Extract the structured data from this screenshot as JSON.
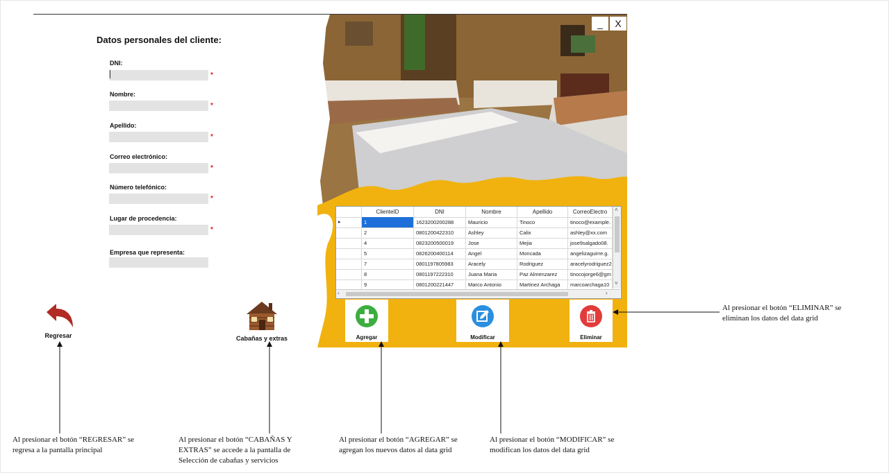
{
  "form": {
    "title": "Datos personales del cliente:",
    "fields": [
      {
        "label": "DNI:",
        "value": "",
        "required": true
      },
      {
        "label": "Nombre:",
        "value": "",
        "required": true
      },
      {
        "label": "Apellido:",
        "value": "",
        "required": true
      },
      {
        "label": "Correo electrónico:",
        "value": "",
        "required": true
      },
      {
        "label": "Número telefónico:",
        "value": "",
        "required": true
      },
      {
        "label": "Lugar de procedencia:",
        "value": "",
        "required": true
      },
      {
        "label": "Empresa que representa:",
        "value": "",
        "required": false
      }
    ],
    "required_mark": "*"
  },
  "window": {
    "minimize": "_",
    "close": "X"
  },
  "grid": {
    "columns": [
      "ClienteID",
      "DNI",
      "Nombre",
      "Apellido",
      "CorreoElectro"
    ],
    "rows": [
      [
        "1",
        "1623200200288",
        "Mauricio",
        "Tinoco",
        "tinoco@example."
      ],
      [
        "2",
        "0801200422310",
        "Ashley",
        "Calix",
        "ashley@xx.com"
      ],
      [
        "4",
        "0823200500019",
        "Jose",
        "Mejia",
        "jose9salgado08."
      ],
      [
        "5",
        "0826200400114",
        "Angel",
        "Moncada",
        "angelizaguirre.g."
      ],
      [
        "7",
        "0801197805983",
        "Aracely",
        "Rodriguez",
        "aracelyrodriguez2"
      ],
      [
        "8",
        "0801197222310",
        "Juana Maria",
        "Paz Almenzarez",
        "tinocojorge6@gm"
      ],
      [
        "9",
        "0801200221447",
        "Marco Antonio",
        "Martinez Archaga",
        "marcoarchaga10"
      ]
    ],
    "selected_row": 0
  },
  "buttons": {
    "agregar": "Agregar",
    "modificar": "Modificar",
    "eliminar": "Eliminar",
    "regresar": "Regresar",
    "cabanas": "Cabañas y extras"
  },
  "colors": {
    "accent_yellow": "#f1b20f",
    "add_green": "#3cae3f",
    "edit_blue": "#2b8fe0",
    "delete_red": "#e23b3b",
    "back_red": "#b12a23"
  },
  "notes": {
    "eliminar": [
      "Al presionar el botón “ELIMINAR”  se",
      "eliminan los datos del data grid"
    ],
    "regresar": [
      "Al presionar el botón “REGRESAR” se",
      "regresa a la pantalla principal"
    ],
    "cabanas": [
      "Al presionar el botón “CABAÑAS Y",
      "EXTRAS” se accede a la pantalla de",
      "Selección de cabañas y servicios"
    ],
    "agregar": [
      "Al presionar el botón “AGREGAR” se",
      "agregan los nuevos datos al data grid"
    ],
    "modificar": [
      "Al presionar el botón “MODIFICAR”  se",
      "modifican los datos del data grid"
    ]
  }
}
